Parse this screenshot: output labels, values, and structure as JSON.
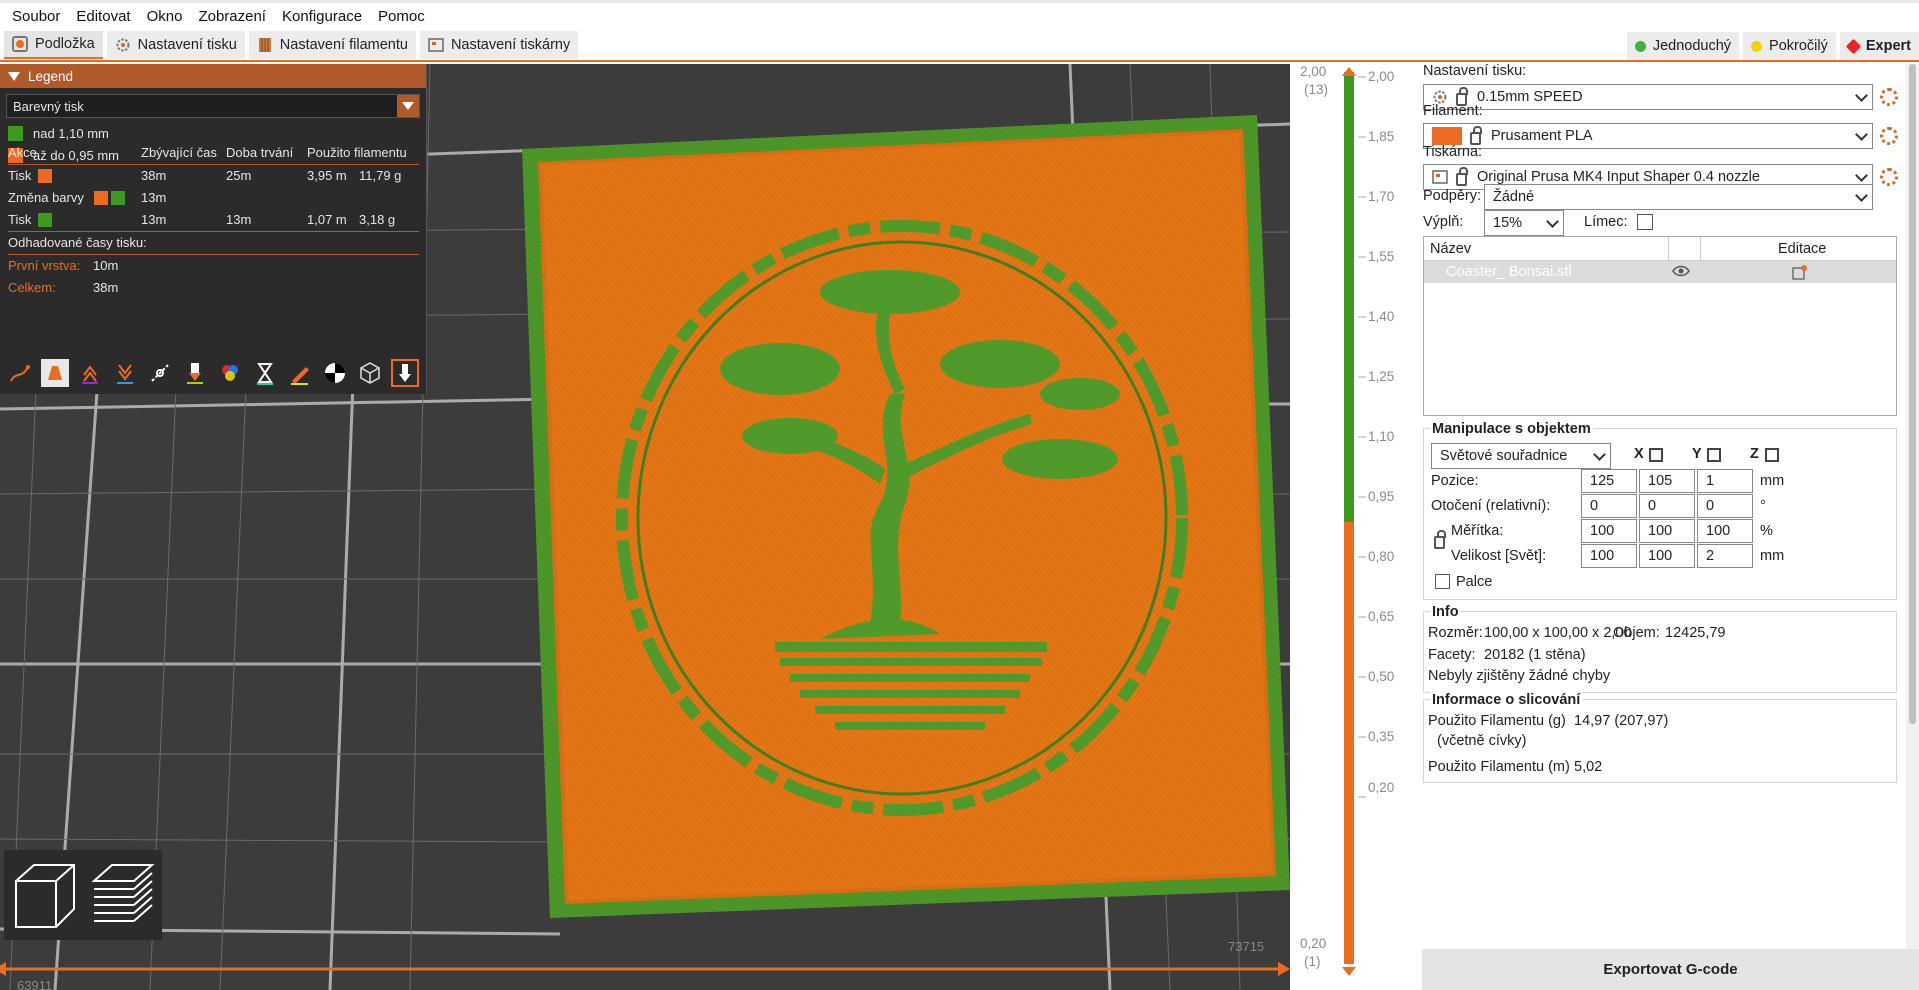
{
  "menu": [
    "Soubor",
    "Editovat",
    "Okno",
    "Zobrazení",
    "Konfigurace",
    "Pomoc"
  ],
  "tabs": [
    {
      "label": "Podložka",
      "icon": "plater-icon",
      "active": true
    },
    {
      "label": "Nastavení tisku",
      "icon": "gear-icon",
      "active": false
    },
    {
      "label": "Nastavení filamentu",
      "icon": "spool-icon",
      "active": false
    },
    {
      "label": "Nastavení tiskárny",
      "icon": "printer-icon",
      "active": false
    }
  ],
  "modes": [
    {
      "label": "Jednoduchý",
      "color": "#3bb43b"
    },
    {
      "label": "Pokročilý",
      "color": "#f2d200"
    },
    {
      "label": "Expert",
      "color": "#e8242a"
    }
  ],
  "legend": {
    "title": "Legend",
    "view_type": "Barevný tisk",
    "ranges": [
      {
        "label": "nad 1,10 mm",
        "color": "#3d9a1e"
      },
      {
        "label": "až do 0,95 mm",
        "color": "#ed6b21"
      }
    ],
    "columns": [
      "Akce",
      "Zbývající čas",
      "Doba trvání",
      "Použito filamentu"
    ],
    "rows": [
      {
        "action": "Tisk",
        "remaining": "38m",
        "duration": "25m",
        "length": "3,95 m",
        "weight": "11,79 g"
      },
      {
        "action": "Změna barvy",
        "remaining": "13m",
        "duration": "",
        "length": "",
        "weight": ""
      },
      {
        "action": "Tisk",
        "remaining": "13m",
        "duration": "13m",
        "length": "1,07 m",
        "weight": "3,18 g"
      }
    ],
    "estimated_title": "Odhadované časy tisku:",
    "first_layer_label": "První vrstva:",
    "first_layer_value": "10m",
    "total_label": "Celkem:",
    "total_value": "38m"
  },
  "vslider": {
    "top_value": "2,00",
    "top_layer": "(13)",
    "bottom_value": "0,20",
    "bottom_layer": "(1)",
    "ticks": [
      "2,00",
      "1,85",
      "1,70",
      "1,55",
      "1,40",
      "1,25",
      "1,10",
      "0,95",
      "0,80",
      "0,65",
      "0,50",
      "0,35",
      "0,20"
    ]
  },
  "hslider": {
    "right_value": "73715",
    "left_value": "63911"
  },
  "right_panel": {
    "print_settings_label": "Nastavení tisku:",
    "print_settings_value": "0.15mm SPEED",
    "filament_label": "Filament:",
    "filament_value": "Prusament PLA",
    "filament_color": "#ed6b21",
    "printer_label": "Tiskárna:",
    "printer_value": "Original Prusa MK4 Input Shaper 0.4 nozzle",
    "supports_label": "Podpěry:",
    "supports_value": "Žádné",
    "infill_label": "Výplň:",
    "infill_value": "15%",
    "brim_label": "Límec:",
    "object_list": {
      "col_name": "Název",
      "col_edit": "Editace",
      "items": [
        {
          "name": "Coaster_ Bonsai.stl"
        }
      ]
    },
    "manipulation": {
      "title": "Manipulace s objektem",
      "coord_system": "Světové souřadnice",
      "axes": [
        "X",
        "Y",
        "Z"
      ],
      "position_label": "Pozice:",
      "position": [
        "125",
        "105",
        "1"
      ],
      "position_unit": "mm",
      "rotation_label": "Otočení (relativní):",
      "rotation": [
        "0",
        "0",
        "0"
      ],
      "rotation_unit": "°",
      "scale_label": "Měřítka:",
      "scale": [
        "100",
        "100",
        "100"
      ],
      "scale_unit": "%",
      "size_label": "Velikost [Svět]:",
      "size": [
        "100",
        "100",
        "2"
      ],
      "size_unit": "mm",
      "inches_label": "Palce"
    },
    "info": {
      "title": "Info",
      "size_label": "Rozměr:",
      "size_value": "100,00 x 100,00 x 2,00",
      "volume_label": "Objem:",
      "volume_value": "12425,79",
      "facets_label": "Facety:",
      "facets_value": "20182 (1 stěna)",
      "errors": "Nebyly zjištěny žádné chyby"
    },
    "slice_info": {
      "title": "Informace o slicování",
      "used_g_label": "Použito Filamentu (g)",
      "used_g_sub": "(včetně cívky)",
      "used_g_value": "14,97 (207,97)",
      "used_m_label": "Použito Filamentu (m)",
      "used_m_value": "5,02"
    },
    "export_button": "Exportovat G-code"
  },
  "colors": {
    "accent": "#ed6b21",
    "green": "#3d9a1e"
  }
}
